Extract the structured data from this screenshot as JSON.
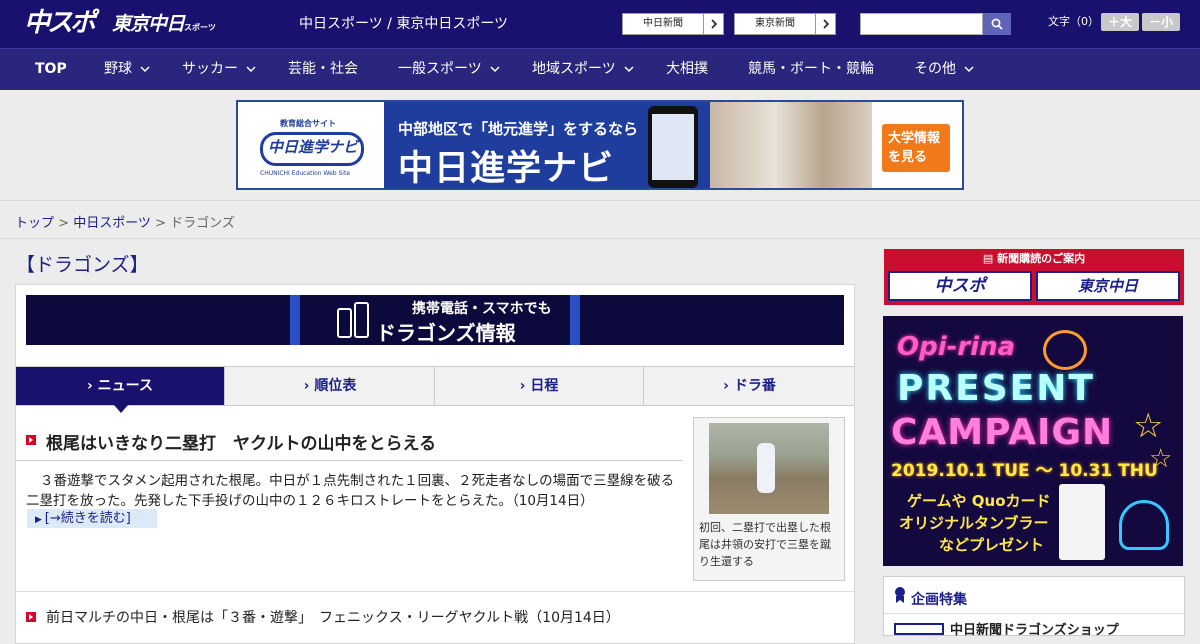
{
  "header": {
    "logo_chusupo": "中スポ",
    "logo_tokyo": "東京中日",
    "logo_tokyo_small": "スポーツ",
    "site_title": "中日スポーツ / 東京中日スポーツ",
    "paper_links": [
      "中日新聞",
      "東京新聞"
    ],
    "search": {
      "placeholder": "",
      "icon": "search-icon"
    },
    "font_size_label": "文字（0）",
    "font_larger": "＋大",
    "font_smaller": "－小",
    "colors": {
      "bar": "#18126e",
      "nav": "#2a257d"
    }
  },
  "nav": {
    "items": [
      {
        "label": "TOP"
      },
      {
        "label": "野球"
      },
      {
        "label": "サッカー"
      },
      {
        "label": "芸能・社会"
      },
      {
        "label": "一般スポーツ"
      },
      {
        "label": "地域スポーツ"
      },
      {
        "label": "大相撲"
      },
      {
        "label": "競馬・ボート・競輪"
      },
      {
        "label": "その他"
      }
    ]
  },
  "ad": {
    "logo_small": "教育総合サイト",
    "logo_main": "中日進学ナビ",
    "logo_sub": "CHUNICHI Education Web Site",
    "line1": "中部地区で「地元進学」をするなら",
    "line2": "中日進学ナビ",
    "cta": "大学情報を見る"
  },
  "breadcrumb": {
    "top": "トップ",
    "sep": " > ",
    "section": "中日スポーツ",
    "current": "ドラゴンズ"
  },
  "page": {
    "title": "【ドラゴンズ】"
  },
  "mobile_banner": {
    "line1": "携帯電話・スマホでも",
    "line2": "ドラゴンズ情報"
  },
  "tabs": [
    {
      "label": "ニュース"
    },
    {
      "label": "順位表"
    },
    {
      "label": "日程"
    },
    {
      "label": "ドラ番"
    }
  ],
  "article": {
    "headline": "根尾はいきなり二塁打　ヤクルトの山中をとらえる",
    "lead": "３番遊撃でスタメン起用された根尾。中日が１点先制された１回裏、２死走者なしの場面で三塁線を破る二塁打を放った。先発した下手投げの山中の１２６キロストレートをとらえた。（10月14日）",
    "read_more": "[→続きを読む]",
    "photo_caption": "初回、二塁打で出塁した根尾は井領の安打で三塁を蹴り生還する"
  },
  "news_list": [
    {
      "text": "前日マルチの中日・根尾は「３番・遊撃」　フェニックス・リーグヤクルト戦（10月14日）"
    }
  ],
  "sidebar": {
    "subscribe_title": "新聞購読のご案内",
    "subscribe_logos": [
      "中スポ",
      "東京中日"
    ],
    "campaign": {
      "brand": "Opi-rina",
      "title1": "PRESENT",
      "title2": "CAMPAIGN",
      "dates": "2019.10.1 TUE 〜 10.31 THU",
      "line1": "ゲームや Quoカード",
      "line2": "オリジナルタンブラー",
      "line3": "などプレゼント"
    },
    "feature_title": "企画特集",
    "feature_item": "中日新聞ドラゴンズショップ"
  }
}
